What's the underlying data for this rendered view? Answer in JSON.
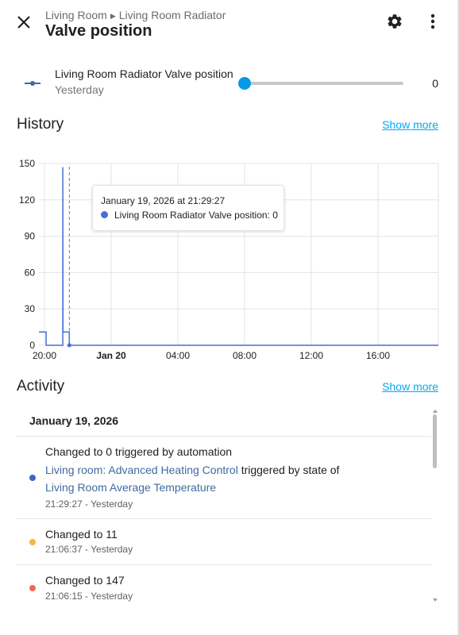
{
  "header": {
    "breadcrumb_area": "Living Room",
    "breadcrumb_device": "Living Room Radiator",
    "title": "Valve position"
  },
  "entity": {
    "name": "Living Room Radiator Valve position",
    "subtitle": "Yesterday",
    "value": "0",
    "slider_fraction": 0
  },
  "history": {
    "title": "History",
    "show_more": "Show more"
  },
  "chart_data": {
    "type": "line",
    "series": [
      {
        "name": "Living Room Radiator Valve position",
        "points": [
          [
            "19:40",
            11
          ],
          [
            "20:06",
            11
          ],
          [
            "20:06",
            0
          ],
          [
            "21:06",
            0
          ],
          [
            "21:06",
            147
          ],
          [
            "21:06:37",
            11
          ],
          [
            "21:29",
            11
          ],
          [
            "21:29:27",
            0
          ],
          [
            "19:00+1d",
            0
          ]
        ]
      }
    ],
    "x_ticks": [
      "20:00",
      "Jan 20",
      "04:00",
      "08:00",
      "12:00",
      "16:00"
    ],
    "y_ticks": [
      "0",
      "30",
      "60",
      "90",
      "120",
      "150"
    ],
    "ylim": [
      0,
      150
    ],
    "grid": true,
    "color": "#4a6ed8"
  },
  "tooltip": {
    "date": "January 19, 2026 at 21:29:27",
    "series_label": "Living Room Radiator Valve position: 0"
  },
  "activity": {
    "title": "Activity",
    "show_more": "Show more",
    "date_header": "January 19, 2026",
    "items": [
      {
        "message": "Changed to 0 triggered by automation",
        "link1": "Living room: Advanced Heating Control",
        "middle": " triggered by state of",
        "link2": "Living Room Average Temperature",
        "time": "21:29:27 - Yesterday",
        "color": "#3e64c8"
      },
      {
        "message": "Changed to 11",
        "time": "21:06:37 - Yesterday",
        "color": "#f4b740"
      },
      {
        "message": "Changed to 147",
        "time": "21:06:15 - Yesterday",
        "color": "#f06a55"
      }
    ]
  },
  "colors": {
    "accent": "#03a9f4",
    "slider": "#039be5",
    "link": "#3f6aa0"
  }
}
